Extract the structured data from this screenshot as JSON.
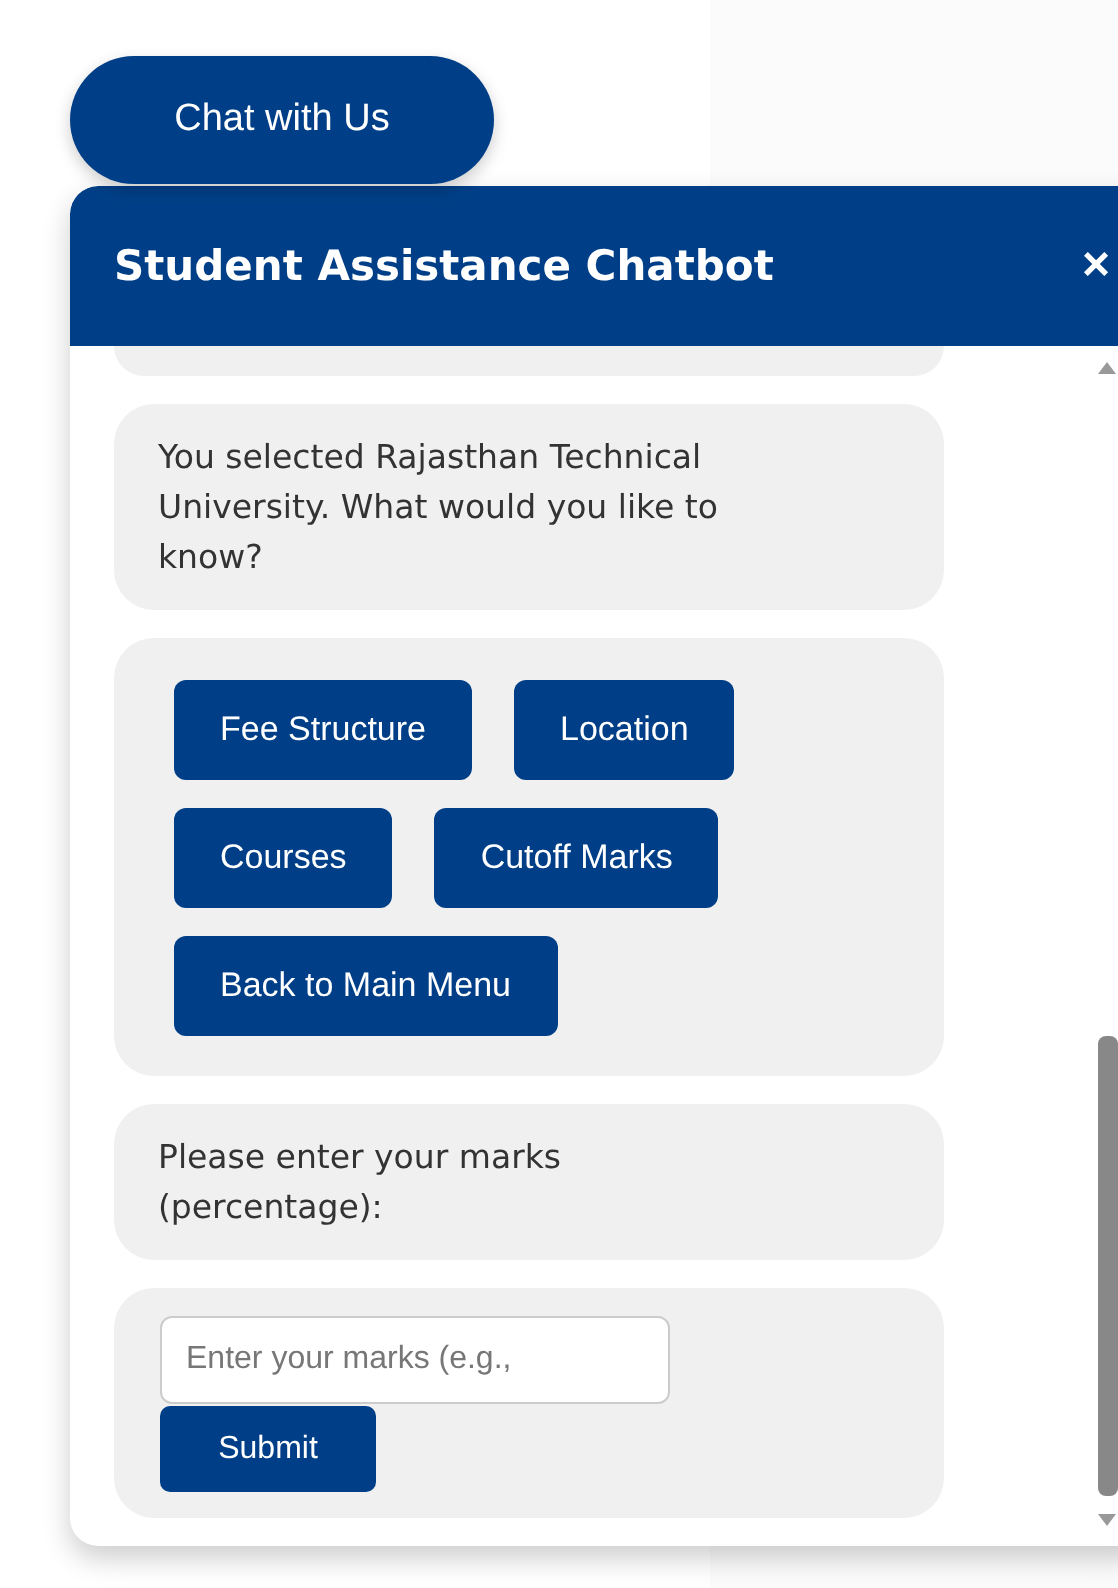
{
  "launcher": {
    "label": "Chat with Us"
  },
  "chatbot": {
    "title": "Student Assistance Chatbot",
    "close": "×",
    "messages": [
      {
        "kind": "partial"
      },
      {
        "kind": "text",
        "text": "You selected Rajasthan Technical University. What would you like to know?"
      },
      {
        "kind": "options",
        "options": [
          "Fee Structure",
          "Location",
          "Courses",
          "Cutoff Marks",
          "Back to Main Menu"
        ]
      },
      {
        "kind": "text",
        "text": "Please enter your marks (percentage):"
      },
      {
        "kind": "input",
        "placeholder": "Enter your marks (e.g.,",
        "button": "Submit"
      }
    ]
  }
}
